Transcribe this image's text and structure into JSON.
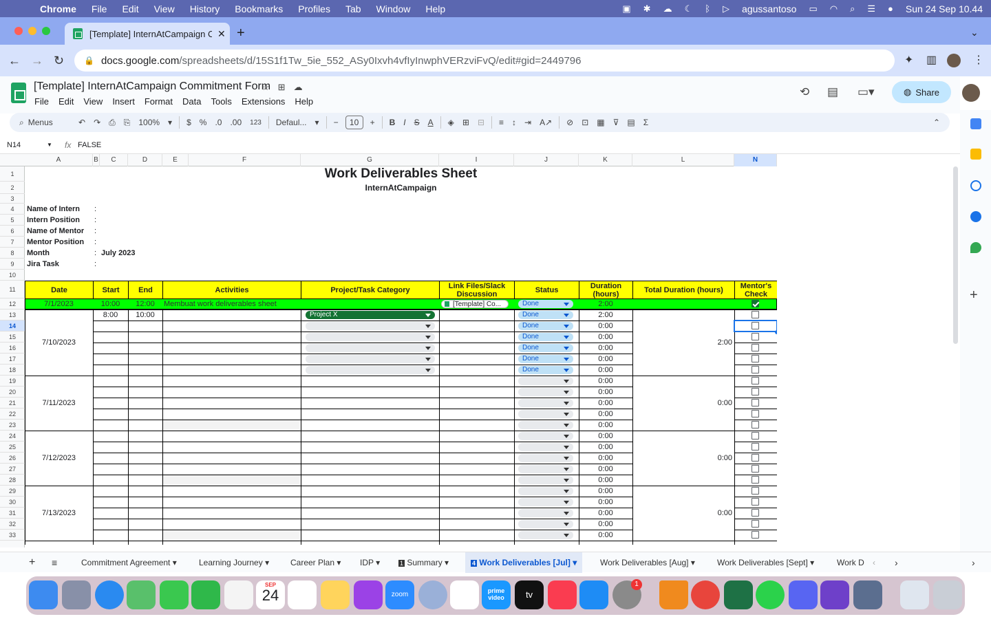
{
  "menubar": {
    "app": "Chrome",
    "items": [
      "File",
      "Edit",
      "View",
      "History",
      "Bookmarks",
      "Profiles",
      "Tab",
      "Window",
      "Help"
    ],
    "user": "agussantoso",
    "clock": "Sun 24 Sep  10.44"
  },
  "browser": {
    "tab_title": "[Template] InternAtCampaign C",
    "url_host": "docs.google.com",
    "url_path": "/spreadsheets/d/15S1f1Tw_5ie_552_ASy0Ixvh4vfIyInwphVERzviFvQ/edit#gid=2449796"
  },
  "sheets": {
    "doc_title": "[Template] InternAtCampaign Commitment Form",
    "menu": [
      "File",
      "Edit",
      "View",
      "Insert",
      "Format",
      "Data",
      "Tools",
      "Extensions",
      "Help"
    ],
    "share_label": "Share",
    "toolbar": {
      "search": "Menus",
      "zoom": "100%",
      "currency": "$",
      "percent": "%",
      "dec_down": ".0",
      "dec_up": ".00",
      "num_format": "123",
      "font": "Defaul...",
      "font_size": "10"
    },
    "name_box": "N14",
    "formula_value": "FALSE"
  },
  "columns": [
    "A",
    "B",
    "C",
    "D",
    "E",
    "F",
    "G",
    "I",
    "J",
    "K",
    "L",
    "N"
  ],
  "rows": [
    "1",
    "2",
    "3",
    "4",
    "5",
    "6",
    "7",
    "8",
    "9",
    "10",
    "11",
    "12",
    "13",
    "14",
    "15",
    "16",
    "17",
    "18",
    "19",
    "20",
    "21",
    "22",
    "23",
    "24",
    "25",
    "26",
    "27",
    "28",
    "29",
    "30",
    "31",
    "32",
    "33"
  ],
  "sheet": {
    "title": "Work Deliverables Sheet",
    "subtitle": "InternAtCampaign",
    "info_labels": [
      "Name of Intern",
      "Intern Position",
      "Name of Mentor",
      "Mentor Position",
      "Month",
      "Jira Task"
    ],
    "info_colon": ":",
    "month_value": "July 2023",
    "headers": {
      "date": "Date",
      "start": "Start",
      "end": "End",
      "activities": "Activities",
      "category": "Project/Task Category",
      "link": "Link Files/Slack Discussion",
      "status": "Status",
      "duration": "Duration (hours)",
      "total": "Total Duration (hours)",
      "mentor": "Mentor's Check"
    },
    "row12": {
      "date": "7/1/2023",
      "start": "10:00",
      "end": "12:00",
      "activity": "Membuat work deliverables sheet",
      "link": "[Template] Co...",
      "status": "Done",
      "duration": "2:00",
      "checked": true
    },
    "row13": {
      "start": "8:00",
      "end": "10:00",
      "category": "Project X",
      "status": "Done",
      "duration": "2:00"
    },
    "status_done": "Done",
    "zero": "0:00",
    "groups": [
      {
        "date": "7/10/2023",
        "total": "2:00"
      },
      {
        "date": "7/11/2023",
        "total": "0:00"
      },
      {
        "date": "7/12/2023",
        "total": "0:00"
      },
      {
        "date": "7/13/2023",
        "total": "0:00"
      }
    ]
  },
  "sheet_tabs": [
    "Commitment Agreement",
    "Learning Journey",
    "Career Plan",
    "IDP",
    "Summary",
    "Work Deliverables [Jul]",
    "Work Deliverables [Aug]",
    "Work Deliverables [Sept]",
    "Work D"
  ],
  "sheet_tab_badges": {
    "summary": "1",
    "jul": "4"
  },
  "dock": {
    "calendar_month": "SEP",
    "calendar_day": "24",
    "settings_badge": "1",
    "zoom_label": "zoom",
    "tv_label": "tv",
    "prime_label": "prime video"
  }
}
